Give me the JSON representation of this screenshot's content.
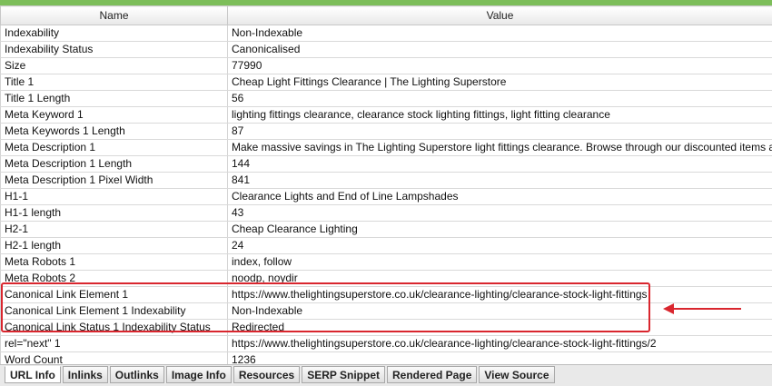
{
  "table": {
    "headers": {
      "name": "Name",
      "value": "Value"
    },
    "rows": [
      {
        "name": "Indexability",
        "value": "Non-Indexable"
      },
      {
        "name": "Indexability Status",
        "value": "Canonicalised"
      },
      {
        "name": "Size",
        "value": "77990"
      },
      {
        "name": "Title 1",
        "value": "Cheap Light Fittings Clearance | The Lighting Superstore"
      },
      {
        "name": "Title 1 Length",
        "value": "56"
      },
      {
        "name": "Meta Keyword 1",
        "value": "lighting fittings clearance, clearance stock lighting fittings, light fitting clearance"
      },
      {
        "name": "Meta Keywords 1 Length",
        "value": "87"
      },
      {
        "name": "Meta Description 1",
        "value": "Make massive savings in The Lighting Superstore light fittings clearance. Browse through our discounted items and"
      },
      {
        "name": "Meta Description 1 Length",
        "value": "144"
      },
      {
        "name": "Meta Description 1 Pixel Width",
        "value": "841"
      },
      {
        "name": "H1-1",
        "value": "Clearance Lights and End of Line Lampshades"
      },
      {
        "name": "H1-1 length",
        "value": "43"
      },
      {
        "name": "H2-1",
        "value": "Cheap Clearance Lighting"
      },
      {
        "name": "H2-1 length",
        "value": "24"
      },
      {
        "name": "Meta Robots 1",
        "value": "index, follow"
      },
      {
        "name": "Meta Robots 2",
        "value": "noodp, noydir"
      },
      {
        "name": "Canonical Link Element 1",
        "value": "https://www.thelightingsuperstore.co.uk/clearance-lighting/clearance-stock-light-fittings"
      },
      {
        "name": "Canonical Link Element 1 Indexability",
        "value": "Non-Indexable"
      },
      {
        "name": "Canonical Link Status 1 Indexability Status",
        "value": "Redirected"
      },
      {
        "name": "rel=\"next\" 1",
        "value": "https://www.thelightingsuperstore.co.uk/clearance-lighting/clearance-stock-light-fittings/2"
      },
      {
        "name": "Word Count",
        "value": "1236"
      }
    ]
  },
  "tabs": [
    {
      "label": "URL Info",
      "active": true
    },
    {
      "label": "Inlinks",
      "active": false
    },
    {
      "label": "Outlinks",
      "active": false
    },
    {
      "label": "Image Info",
      "active": false
    },
    {
      "label": "Resources",
      "active": false
    },
    {
      "label": "SERP Snippet",
      "active": false
    },
    {
      "label": "Rendered Page",
      "active": false
    },
    {
      "label": "View Source",
      "active": false
    }
  ],
  "annotation": {
    "color": "#d9262e"
  },
  "colors": {
    "accent_line": "#7dbe5a"
  }
}
